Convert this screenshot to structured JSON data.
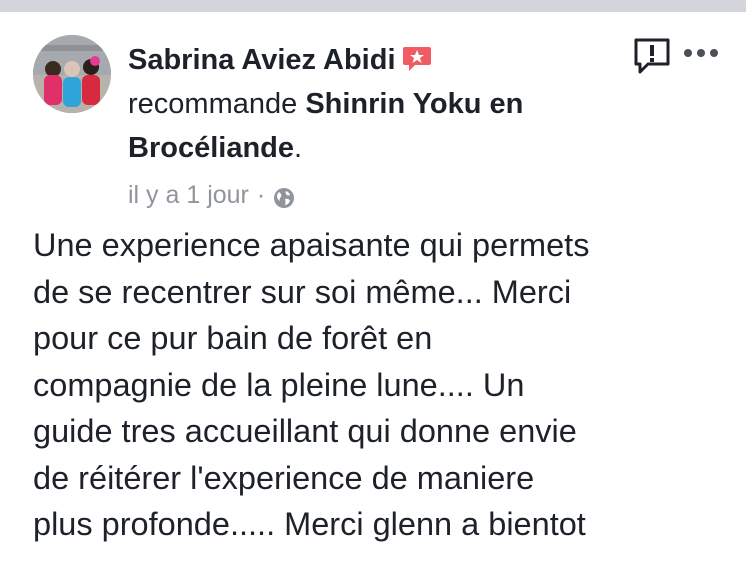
{
  "post": {
    "author": "Sabrina Aviez Abidi",
    "verb": "recommande",
    "page_name": "Shinrin Yoku en Brocéliande",
    "period": ".",
    "timestamp": "il y a 1 jour",
    "separator": "·",
    "body": "Une experience apaisante qui permets\nde se recentrer sur soi même... Merci\npour ce pur bain de forêt en\ncompagnie de la pleine lune.... Un\nguide tres accueillant qui donne envie\nde réitérer l'experience de maniere\nplus profonde..... Merci glenn a bientot"
  },
  "icons": {
    "badge": "recommendation-star-icon",
    "privacy": "globe-icon",
    "report": "report-exclamation-icon",
    "more": "more-options-icon"
  },
  "colors": {
    "text": "#1d2129",
    "meta": "#90949c",
    "badge": "#f05b64",
    "top_bar": "#d3d5da"
  }
}
